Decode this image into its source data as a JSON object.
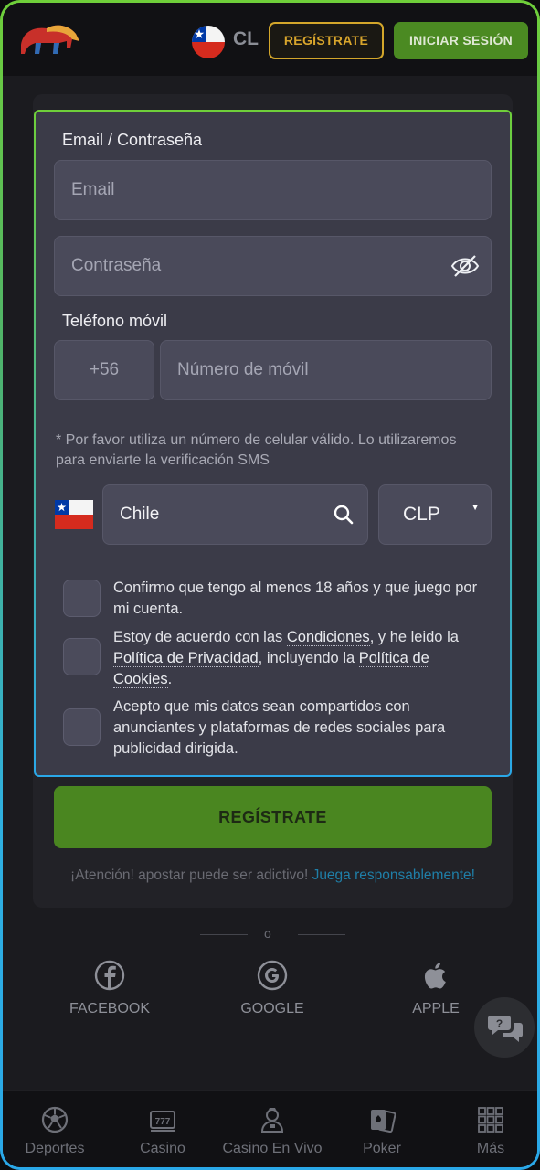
{
  "header": {
    "country_code": "CL",
    "register_label": "REGÍSTRATE",
    "login_label": "INICIAR SESIÓN"
  },
  "form": {
    "section_email_label": "Email / Contraseña",
    "email_placeholder": "Email",
    "password_placeholder": "Contraseña",
    "section_phone_label": "Teléfono móvil",
    "phone_prefix": "+56",
    "phone_placeholder": "Número de móvil",
    "phone_note": "* Por favor utiliza un número de celular válido. Lo utilizaremos para enviarte la verificación SMS",
    "country_value": "Chile",
    "currency_value": "CLP",
    "checks": {
      "age_text": "Confirmo que tengo al menos 18 años y que juego por mi cuenta.",
      "terms_prefix": "Estoy de acuerdo con las ",
      "terms_link": "Condiciones",
      "terms_mid": ", y he leido la ",
      "privacy_link": "Política de Privacidad",
      "terms_mid2": ", incluyendo la ",
      "cookies_link": "Política de Cookies",
      "terms_end": ".",
      "data_text": "Acepto que mis datos sean compartidos con anunciantes y plataformas de redes sociales para publicidad dirigida."
    },
    "submit_label": "REGÍSTRATE",
    "warning_text": "¡Atención! apostar puede ser adictivo! ",
    "warning_link": "Juega responsablemente!"
  },
  "divider_text": "o",
  "social": {
    "facebook": "FACEBOOK",
    "google": "GOOGLE",
    "apple": "APPLE"
  },
  "nav": {
    "sports": "Deportes",
    "casino": "Casino",
    "live_casino": "Casino En Vivo",
    "poker": "Poker",
    "more": "Más"
  },
  "colors": {
    "accent_green": "#4a8620",
    "accent_gold": "#d3a62b",
    "link_blue": "#1f7fa8"
  },
  "icons": [
    "logo-icon",
    "chile-flag-icon",
    "eye-off-icon",
    "search-icon",
    "chevron-down-icon",
    "facebook-icon",
    "google-icon",
    "apple-icon",
    "chat-icon",
    "soccer-ball-icon",
    "slot-machine-icon",
    "dealer-icon",
    "cards-icon",
    "grid-icon"
  ]
}
